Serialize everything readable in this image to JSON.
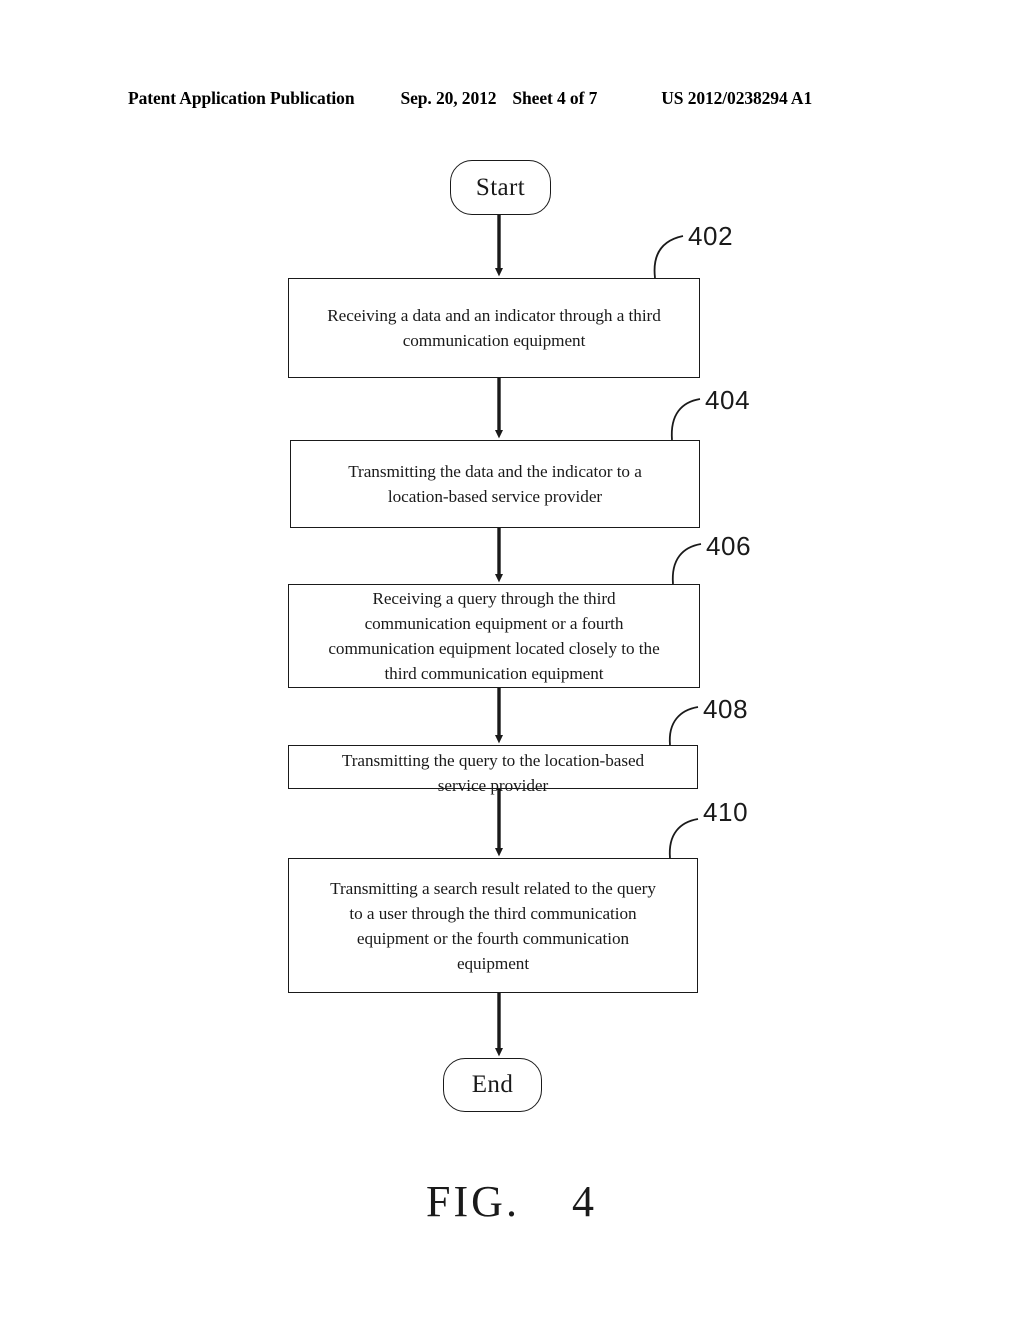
{
  "header": {
    "publication": "Patent Application Publication",
    "date": "Sep. 20, 2012",
    "sheet": "Sheet 4 of 7",
    "patent_number": "US 2012/0238294 A1"
  },
  "figure": {
    "label_word": "FIG.",
    "label_number": "4"
  },
  "flowchart": {
    "start_label": "Start",
    "end_label": "End",
    "steps": [
      {
        "ref": "402",
        "text": "Receiving a data and an indicator through a third\ncommunication equipment"
      },
      {
        "ref": "404",
        "text": "Transmitting the data and the indicator to a\nlocation-based service provider"
      },
      {
        "ref": "406",
        "text": "Receiving a query through the third\ncommunication equipment or a fourth\ncommunication equipment located closely to the\nthird communication equipment"
      },
      {
        "ref": "408",
        "text": "Transmitting the query to the location-based\nservice provider"
      },
      {
        "ref": "410",
        "text": "Transmitting a search result related to the query\nto a user through the third communication\nequipment or the fourth communication\nequipment"
      }
    ]
  },
  "colors": {
    "ink": "#1a1a1a",
    "paper": "#ffffff"
  }
}
